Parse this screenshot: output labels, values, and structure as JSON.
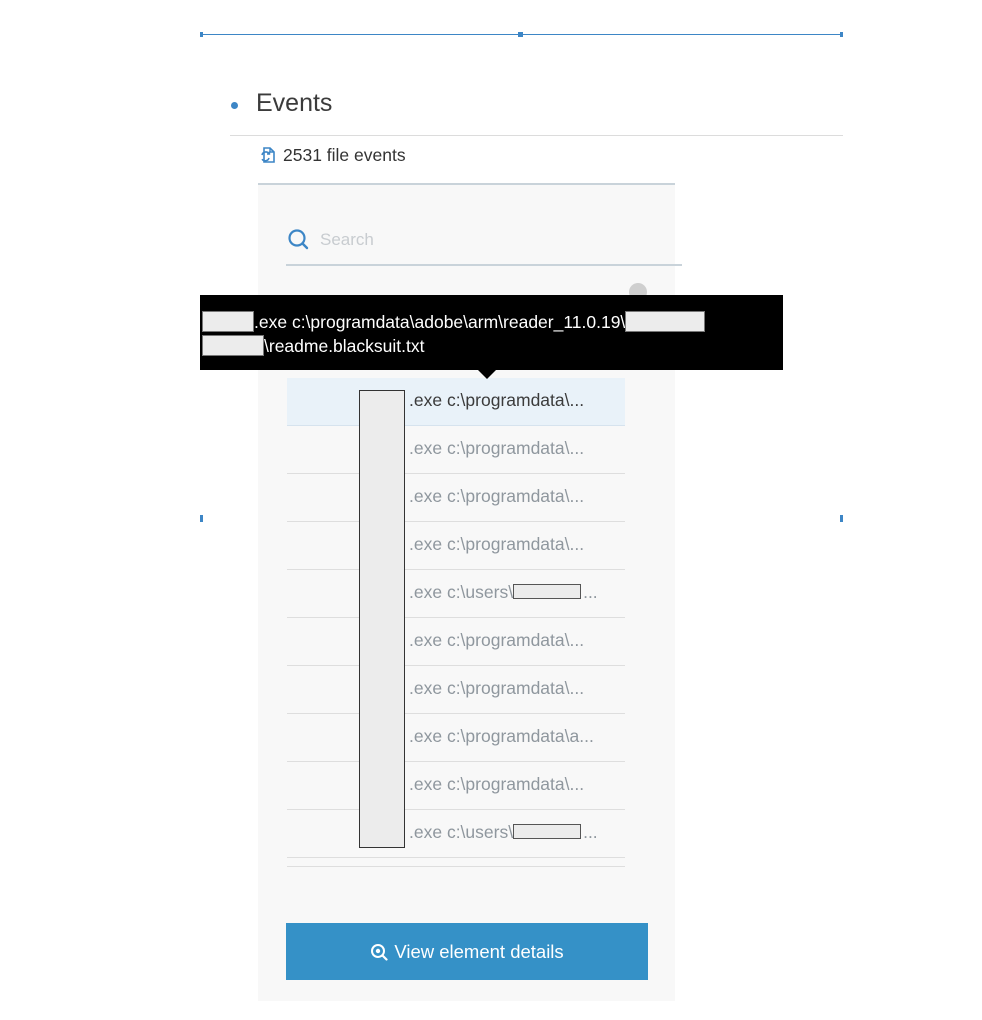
{
  "section": {
    "title": "Events"
  },
  "file_events": {
    "count_label": "2531 file events"
  },
  "search": {
    "placeholder": "Search"
  },
  "tooltip": {
    "line1_text": ".exe c:\\programdata\\adobe\\arm\\reader_11.0.19\\",
    "line2_text": "\\readme.blacksuit.txt"
  },
  "events_list": [
    {
      "text": ".exe c:\\programdata\\...",
      "selected": true
    },
    {
      "text": ".exe c:\\programdata\\..."
    },
    {
      "text": ".exe c:\\programdata\\..."
    },
    {
      "text": ".exe c:\\programdata\\..."
    },
    {
      "text": ".exe c:\\users\\",
      "suffix": "..."
    },
    {
      "text": ".exe c:\\programdata\\..."
    },
    {
      "text": ".exe c:\\programdata\\..."
    },
    {
      "text": ".exe c:\\programdata\\a..."
    },
    {
      "text": ".exe c:\\programdata\\..."
    },
    {
      "text": ".exe c:\\users\\",
      "suffix": "..."
    }
  ],
  "actions": {
    "view_details_label": "View element details"
  },
  "colors": {
    "accent": "#3591c7",
    "selected_row": "#e9f2f9",
    "tooltip_bg": "#000000"
  }
}
